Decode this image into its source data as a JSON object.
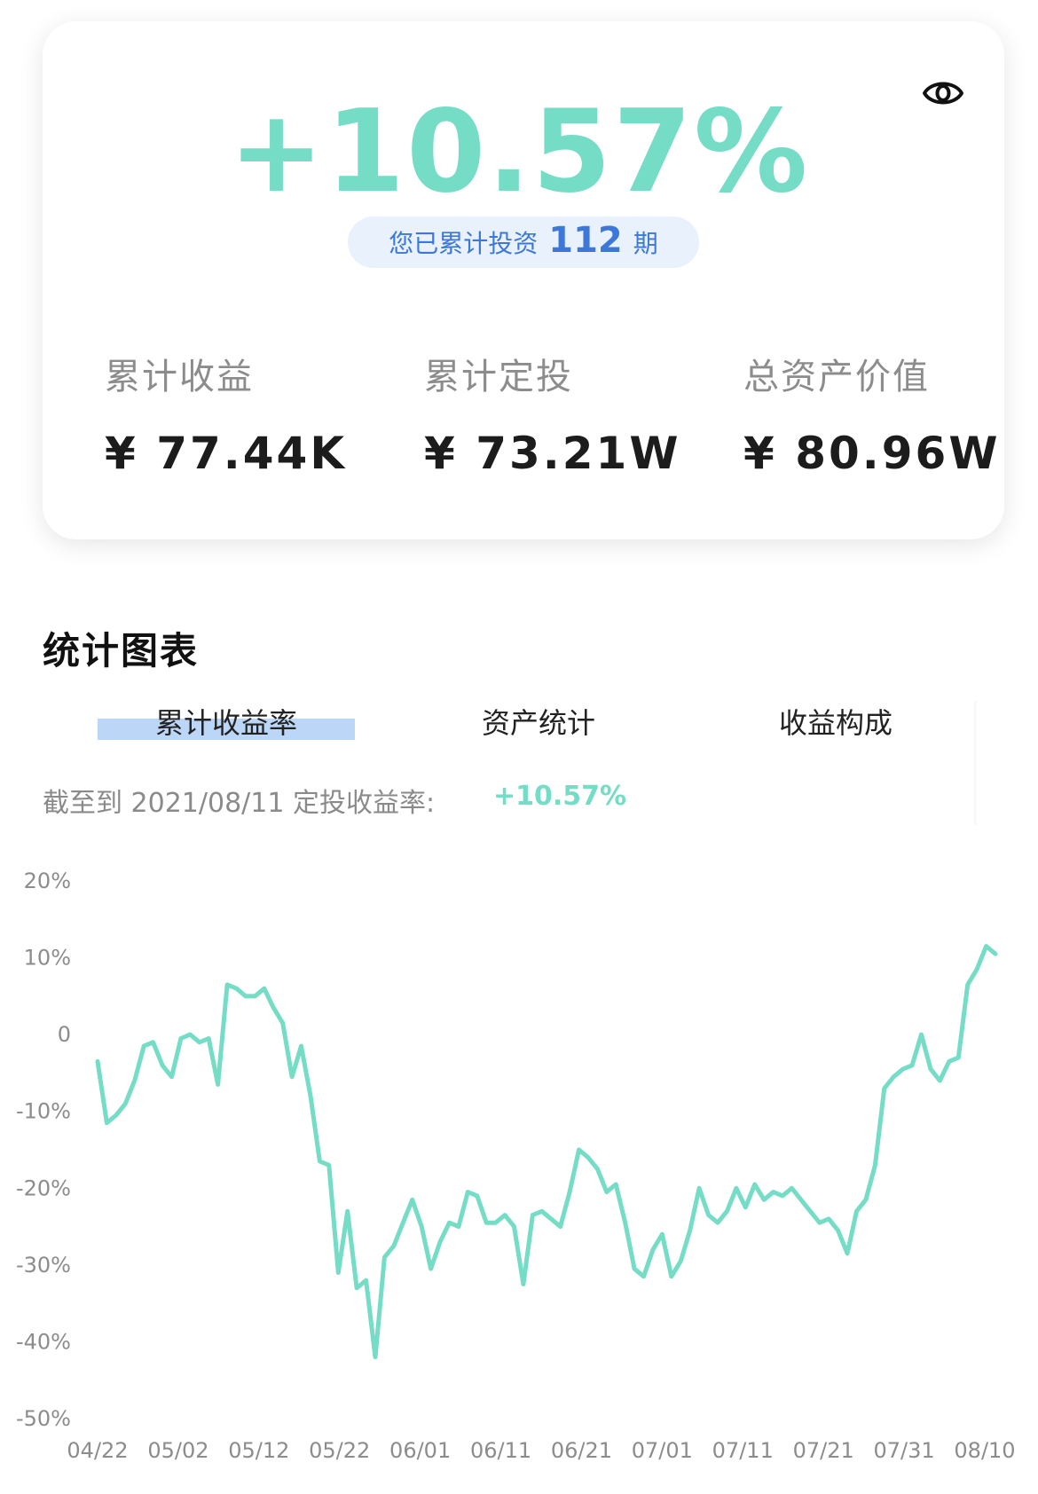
{
  "summary": {
    "total_return_rate": "+10.57%",
    "periods_prefix": "您已累计投资",
    "periods_count": "112",
    "periods_suffix": "期",
    "metrics": [
      {
        "label": "累计收益",
        "value": "¥ 77.44K"
      },
      {
        "label": "累计定投",
        "value": "¥ 73.21W"
      },
      {
        "label": "总资产价值",
        "value": "¥ 80.96W"
      }
    ]
  },
  "icons": {
    "visibility": "eye-icon"
  },
  "section": {
    "title": "统计图表",
    "tabs": [
      {
        "label": "累计收益率",
        "active": true
      },
      {
        "label": "资产统计",
        "active": false
      },
      {
        "label": "收益构成",
        "active": false
      }
    ],
    "as_of_text": "截至到 2021/08/11 定投收益率:",
    "as_of_value": "+10.57%"
  },
  "colors": {
    "accent": "#75dcc6",
    "pill_bg": "#e8f1fc",
    "pill_text": "#3d78d8",
    "tab_highlight": "#bcd6f8"
  },
  "chart_data": {
    "type": "line",
    "ylim": [
      -50,
      20
    ],
    "y_ticks": [
      "20%",
      "10%",
      "0",
      "-10%",
      "-20%",
      "-30%",
      "-40%",
      "-50%"
    ],
    "y_tick_values": [
      20,
      10,
      0,
      -10,
      -20,
      -30,
      -40,
      -50
    ],
    "x_ticks": [
      "04/22",
      "05/02",
      "05/12",
      "05/22",
      "06/01",
      "06/11",
      "06/21",
      "07/01",
      "07/11",
      "07/21",
      "07/31",
      "08/10"
    ],
    "x_start": "04/22",
    "x_end": "08/11",
    "grid": false,
    "legend": "none",
    "series": [
      {
        "values": [
          -3.5,
          -11.5,
          -10.5,
          -9.0,
          -6.0,
          -1.5,
          -1.0,
          -4.0,
          -5.5,
          -0.5,
          0.0,
          -1.0,
          -0.5,
          -6.5,
          6.5,
          6.0,
          5.0,
          5.0,
          6.0,
          3.5,
          1.5,
          -5.5,
          -1.5,
          -8.0,
          -16.5,
          -17.0,
          -31.0,
          -23.0,
          -33.0,
          -32.0,
          -42.0,
          -29.0,
          -27.5,
          -24.5,
          -21.5,
          -25.0,
          -30.5,
          -27.0,
          -24.5,
          -25.0,
          -20.5,
          -21.0,
          -24.5,
          -24.5,
          -23.5,
          -25.0,
          -32.5,
          -23.5,
          -23.0,
          -24.0,
          -25.0,
          -20.5,
          -15.0,
          -16.0,
          -17.5,
          -20.5,
          -19.5,
          -24.5,
          -30.5,
          -31.5,
          -28.0,
          -26.0,
          -31.5,
          -29.5,
          -25.5,
          -20.0,
          -23.5,
          -24.5,
          -23.0,
          -20.0,
          -22.5,
          -19.5,
          -21.5,
          -20.5,
          -21.0,
          -20.0,
          -21.5,
          -23.0,
          -24.5,
          -24.0,
          -25.5,
          -28.5,
          -23.0,
          -21.5,
          -17.0,
          -7.0,
          -5.5,
          -4.5,
          -4.0,
          0.0,
          -4.5,
          -6.0,
          -3.5,
          -3.0,
          6.5,
          8.5,
          11.5,
          10.5
        ]
      }
    ]
  }
}
